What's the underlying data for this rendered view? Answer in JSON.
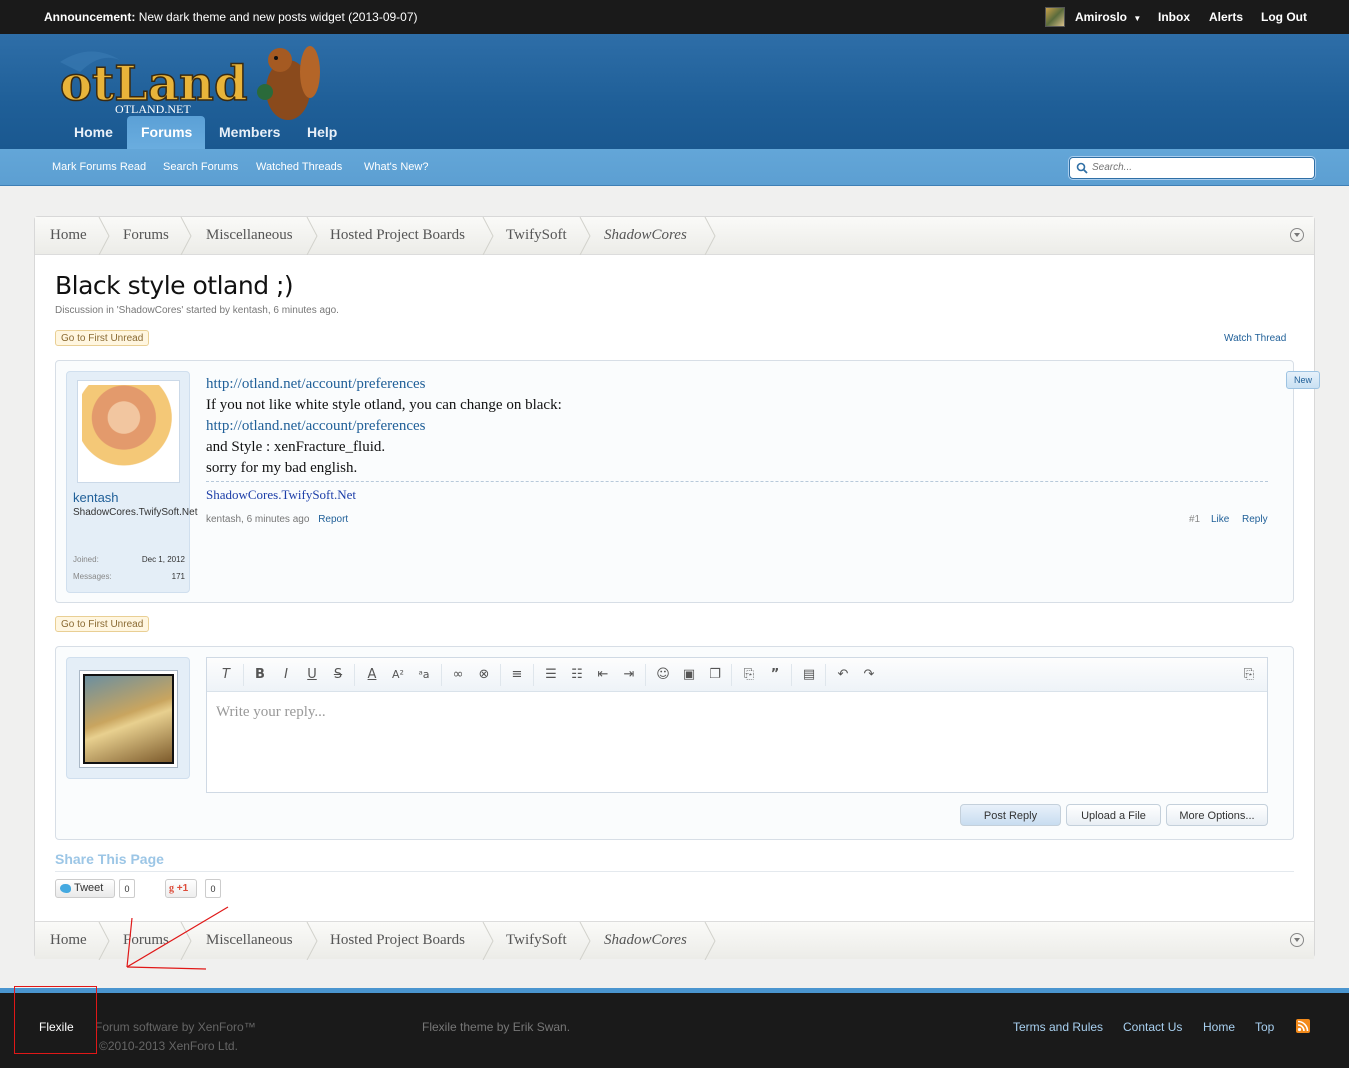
{
  "topbar": {
    "announcement_label": "Announcement:",
    "announcement_text": "New dark theme and new posts widget (2013-09-07)",
    "username": "Amiroslo",
    "inbox": "Inbox",
    "alerts": "Alerts",
    "logout": "Log Out"
  },
  "header": {
    "logo_text": "otLand",
    "logo_sub": "OTLAND.NET",
    "tabs": [
      {
        "label": "Home"
      },
      {
        "label": "Forums"
      },
      {
        "label": "Members"
      },
      {
        "label": "Help"
      }
    ]
  },
  "subnav": {
    "items": [
      "Mark Forums Read",
      "Search Forums",
      "Watched Threads",
      "What's New?"
    ],
    "search_placeholder": "Search..."
  },
  "breadcrumb": [
    "Home",
    "Forums",
    "Miscellaneous",
    "Hosted Project Boards",
    "TwifySoft",
    "ShadowCores"
  ],
  "thread": {
    "title": "Black style otland ;)",
    "meta": "Discussion in 'ShadowCores' started by kentash, 6 minutes ago.",
    "go_first_unread": "Go to First Unread",
    "watch_thread": "Watch Thread"
  },
  "post": {
    "username": "kentash",
    "user_title": "ShadowCores.TwifySoft.Net",
    "joined_label": "Joined:",
    "joined_value": "Dec 1, 2012",
    "messages_label": "Messages:",
    "messages_value": "171",
    "lines": [
      "http://otland.net/account/preferences",
      "If you not like white style otland, you can change on black:",
      "http://otland.net/account/preferences",
      "and Style : xenFracture_fluid.",
      "sorry for my bad english."
    ],
    "signature": "ShadowCores.TwifySoft.Net",
    "meta": "kentash, 6 minutes ago",
    "report": "Report",
    "number": "#1",
    "like": "Like",
    "reply": "Reply",
    "new_badge": "New"
  },
  "reply_box": {
    "placeholder": "Write your reply...",
    "post_reply": "Post Reply",
    "upload": "Upload a File",
    "more": "More Options..."
  },
  "share": {
    "title": "Share This Page",
    "tweet": "Tweet",
    "tweet_count": "0",
    "gplus": "+1",
    "gplus_count": "0"
  },
  "footer": {
    "style_chooser": "Flexile",
    "software": "Forum software by XenForo™",
    "copyright": "©2010-2013 XenForo Ltd.",
    "theme_credit": "Flexile theme by Erik Swan.",
    "links": [
      "Terms and Rules",
      "Contact Us",
      "Home",
      "Top"
    ]
  },
  "colors": {
    "header_blue": "#2e6ea8",
    "subnav_blue": "#63a6d8",
    "link_blue": "#1f5f98",
    "annotation_red": "#e01818"
  }
}
